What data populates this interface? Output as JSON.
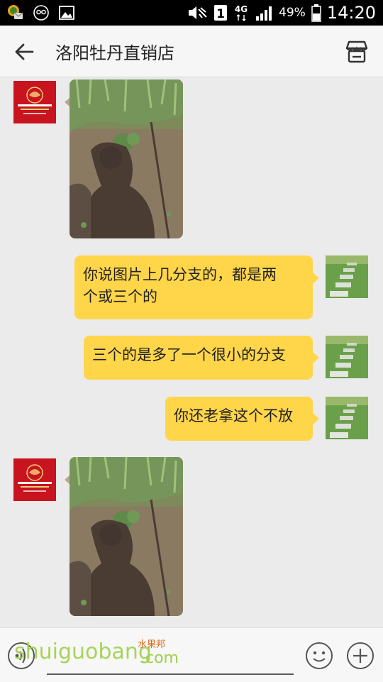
{
  "status_bar": {
    "network": "4G",
    "sim_slot": "1",
    "battery_percent": "49%",
    "time": "14:20"
  },
  "header": {
    "title": "洛阳牡丹直销店"
  },
  "messages": [
    {
      "side": "left",
      "type": "image"
    },
    {
      "side": "right",
      "type": "text",
      "lines": [
        "你说图片上几分支的，都是两",
        "个或三个的"
      ]
    },
    {
      "side": "right",
      "type": "text",
      "lines": [
        "三个的是多了一个很小的分支"
      ]
    },
    {
      "side": "right",
      "type": "text",
      "lines": [
        "你还老拿这个不放"
      ]
    },
    {
      "side": "left",
      "type": "image"
    }
  ],
  "watermark": {
    "main": "shuiguobang",
    "cn": "水果邦",
    "suffix": ".com"
  },
  "colors": {
    "bubble": "#ffd54a",
    "brand_avatar": "#c8141e"
  }
}
